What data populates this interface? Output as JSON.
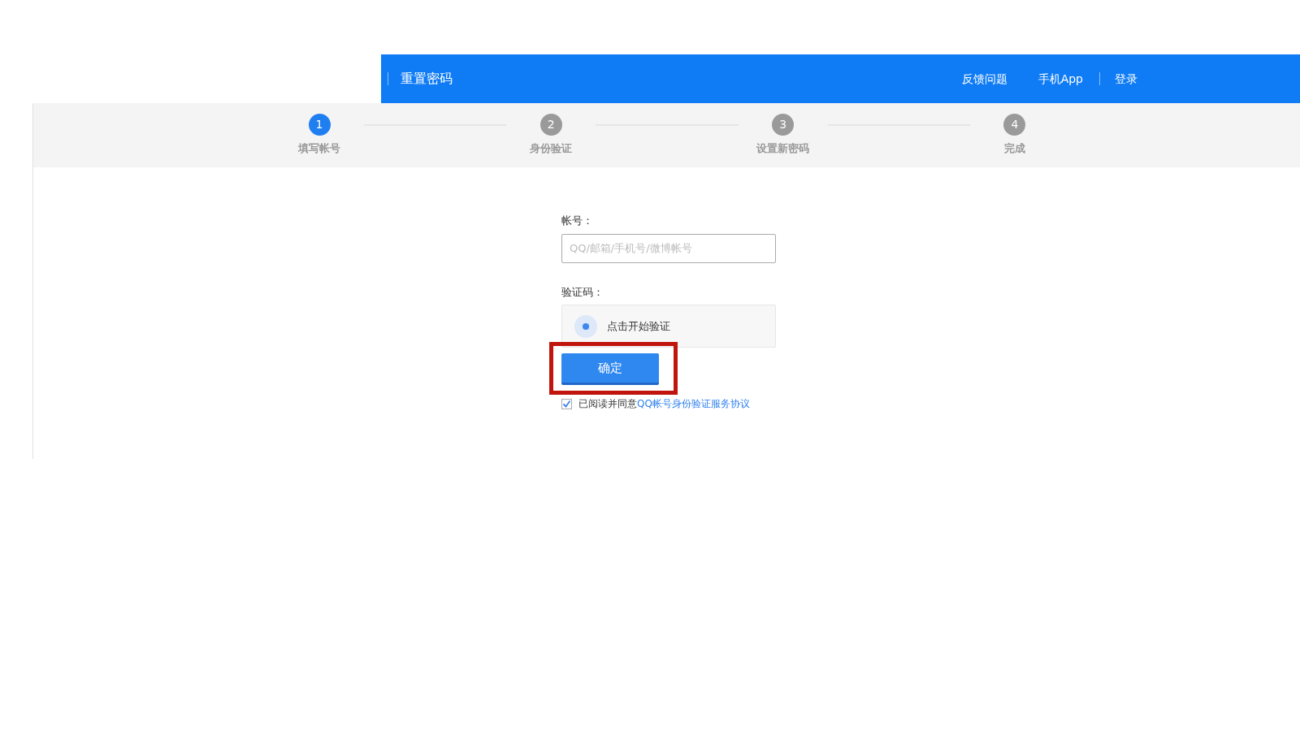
{
  "header": {
    "title": "重置密码",
    "links": [
      {
        "label": "反馈问题",
        "separator_before": false
      },
      {
        "label": "手机App",
        "separator_before": false
      },
      {
        "label": "登录",
        "separator_before": true
      }
    ]
  },
  "steps": [
    {
      "number": "1",
      "label": "填写帐号",
      "selected": true
    },
    {
      "number": "2",
      "label": "身份验证",
      "selected": false
    },
    {
      "number": "3",
      "label": "设置新密码",
      "selected": false
    },
    {
      "number": "4",
      "label": "完成",
      "selected": false
    }
  ],
  "form": {
    "account_label": "帐号：",
    "account_placeholder": "QQ/邮箱/手机号/微博帐号",
    "captcha_label": "验证码：",
    "captcha_text": "点击开始验证",
    "submit": {
      "label": "确定",
      "highlighted": true
    },
    "agreement": {
      "checked": true,
      "text": "已阅读并同意",
      "link": "QQ帐号身份验证服务协议"
    }
  }
}
